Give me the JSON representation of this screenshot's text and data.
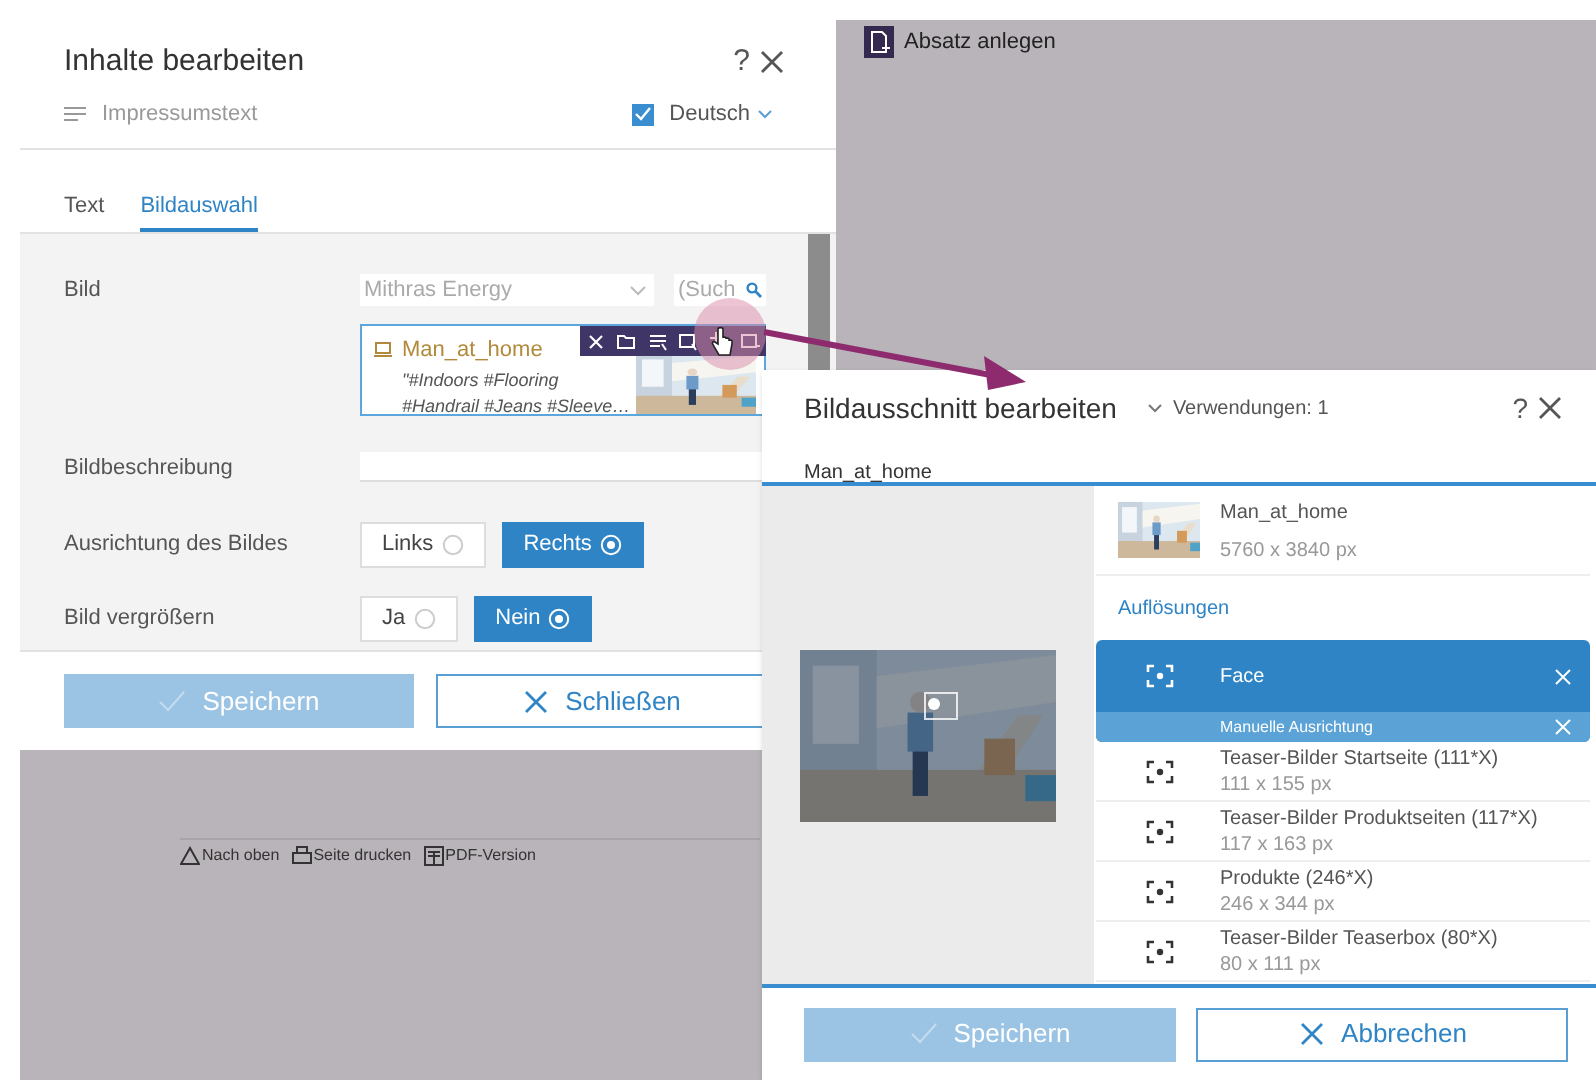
{
  "background": {
    "action_label": "Absatz anlegen",
    "footer_links": [
      {
        "label": "Nach oben",
        "kind": "top"
      },
      {
        "label": "Seite drucken",
        "kind": "print"
      },
      {
        "label": "PDF-Version",
        "kind": "pdf"
      }
    ]
  },
  "content_dialog": {
    "title": "Inhalte bearbeiten",
    "help_label": "?",
    "context": {
      "label": "Impressumstext"
    },
    "language": {
      "label": "Deutsch",
      "checked": true
    },
    "tabs": [
      {
        "label": "Text",
        "selected": false
      },
      {
        "label": "Bildauswahl",
        "selected": true
      }
    ],
    "image_field": {
      "label": "Bild",
      "source": "Mithras Energy",
      "search_placeholder": "(Such",
      "asset": {
        "name": "Man_at_home",
        "tag_lines": [
          "\"#Indoors #Flooring",
          "#Handrail #Jeans #Sleeve…"
        ]
      }
    },
    "description_field": {
      "label": "Bildbeschreibung"
    },
    "option_groups": [
      {
        "label": "Ausrichtung des Bildes",
        "options": [
          {
            "label": "Links",
            "selected": false
          },
          {
            "label": "Rechts",
            "selected": true
          }
        ]
      },
      {
        "label": "Bild vergrößern",
        "options": [
          {
            "label": "Ja",
            "selected": false
          },
          {
            "label": "Nein",
            "selected": true
          }
        ]
      }
    ],
    "buttons": [
      {
        "label": "Speichern",
        "kind": "save",
        "disabled": true
      },
      {
        "label": "Schließen",
        "kind": "cancel",
        "disabled": false
      }
    ]
  },
  "crop_dialog": {
    "title": "Bildausschnitt bearbeiten",
    "usages": "Verwendungen: 1",
    "help_label": "?",
    "image_name": "Man_at_home",
    "info": {
      "name": "Man_at_home",
      "dimensions": "5760 x 3840 px"
    },
    "section_label": "Auflösungen",
    "resolutions": [
      {
        "name": "Face",
        "selected": true,
        "mode": "Manuelle Ausrichtung"
      },
      {
        "name": "Teaser-Bilder Startseite (111*X)",
        "size": "111 x 155 px",
        "selected": false
      },
      {
        "name": "Teaser-Bilder Produktseiten (117*X)",
        "size": "117 x 163 px",
        "selected": false
      },
      {
        "name": "Produkte (246*X)",
        "size": "246 x 344 px",
        "selected": false
      },
      {
        "name": "Teaser-Bilder Teaserbox (80*X)",
        "size": "80 x 111 px",
        "selected": false
      }
    ],
    "buttons": [
      {
        "label": "Speichern",
        "kind": "save",
        "disabled": true
      },
      {
        "label": "Abbrechen",
        "kind": "cancel",
        "disabled": false
      }
    ]
  }
}
